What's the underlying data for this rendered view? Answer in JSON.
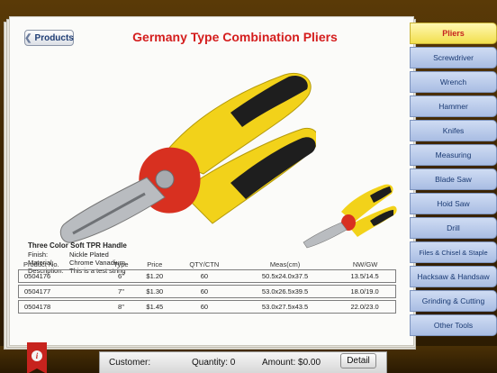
{
  "nav": {
    "back_label": "Products"
  },
  "product": {
    "title": "Germany Type Combination Pliers",
    "subtitle": "Three Color Soft TPR Handle",
    "specs": [
      {
        "label": "Finish:",
        "value": "Nickle Plated"
      },
      {
        "label": "Material:",
        "value": "Chrome Vanadium"
      },
      {
        "label": "Description:",
        "value": "This is a test string"
      }
    ]
  },
  "table": {
    "headers": [
      "Product No.",
      "Type",
      "Price",
      "QTY/CTN",
      "Meas(cm)",
      "NW/GW"
    ],
    "rows": [
      [
        "0504176",
        "6\"",
        "$1.20",
        "60",
        "50.5x24.0x37.5",
        "13.5/14.5"
      ],
      [
        "0504177",
        "7\"",
        "$1.30",
        "60",
        "53.0x26.5x39.5",
        "18.0/19.0"
      ],
      [
        "0504178",
        "8\"",
        "$1.45",
        "60",
        "53.0x27.5x43.5",
        "22.0/23.0"
      ]
    ]
  },
  "categories": [
    {
      "label": "Pliers",
      "active": true
    },
    {
      "label": "Screwdriver"
    },
    {
      "label": "Wrench"
    },
    {
      "label": "Hammer"
    },
    {
      "label": "Knifes"
    },
    {
      "label": "Measuring"
    },
    {
      "label": "Blade Saw"
    },
    {
      "label": "Hoid Saw"
    },
    {
      "label": "Drill"
    },
    {
      "label": "Files & Chisel & Staple"
    },
    {
      "label": "Hacksaw & Handsaw"
    },
    {
      "label": "Grinding & Cutting"
    },
    {
      "label": "Other Tools"
    }
  ],
  "bottom": {
    "customer": "Customer:",
    "quantity": "Quantity: 0",
    "amount": "Amount: $0.00",
    "detail_label": "Detail",
    "info_glyph": "i"
  },
  "colors": {
    "accent_red": "#d41d1d",
    "tab_blue": "#a9bde3",
    "tab_active_yellow": "#f2df4e",
    "cover_brown": "#3f2704"
  }
}
